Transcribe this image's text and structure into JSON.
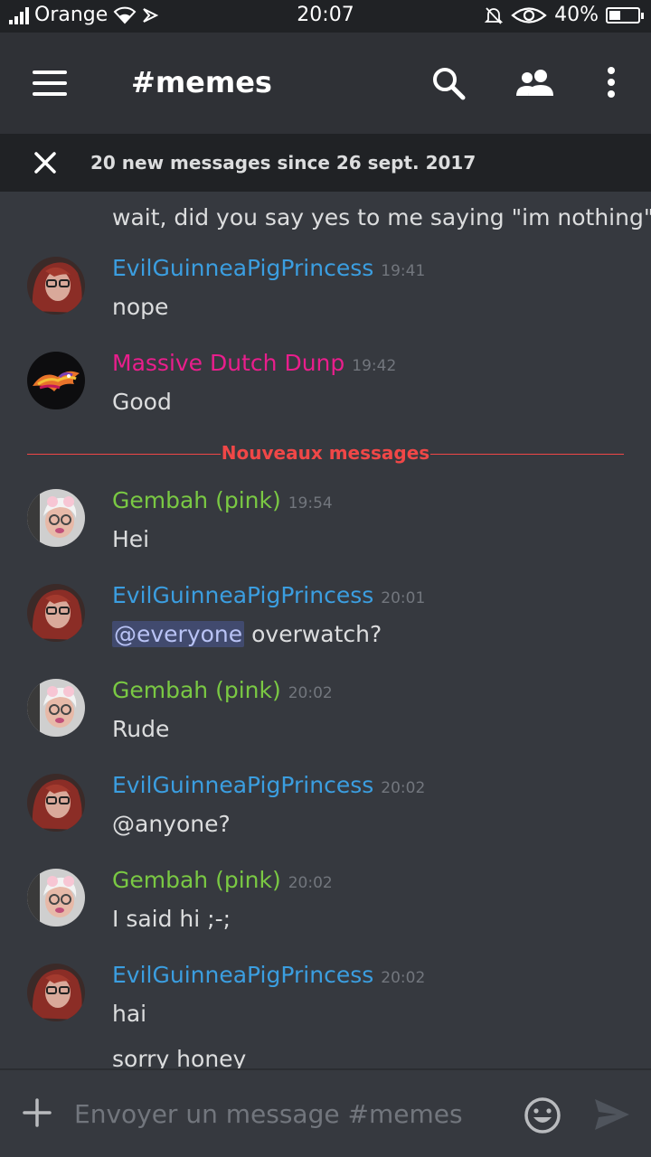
{
  "status_bar": {
    "carrier": "Orange",
    "time": "20:07",
    "battery": "40%",
    "battery_level": 0.4
  },
  "header": {
    "channel_title": "#memes"
  },
  "banner": {
    "text": "20 new messages since 26 sept. 2017"
  },
  "messages": {
    "m0": {
      "text": "wait, did you say yes to me saying \"im nothing\""
    },
    "m1": {
      "author": "EvilGuinneaPigPrincess",
      "time": "19:41",
      "text": "nope"
    },
    "m2": {
      "author": "Massive Dutch Dunp",
      "time": "19:42",
      "text": "Good"
    },
    "divider": "Nouveaux messages",
    "m3": {
      "author": "Gembah (pink)",
      "time": "19:54",
      "text": "Hei"
    },
    "m4": {
      "author": "EvilGuinneaPigPrincess",
      "time": "20:01",
      "mention": "@everyone",
      "text": " overwatch?"
    },
    "m5": {
      "author": "Gembah (pink)",
      "time": "20:02",
      "text": "Rude"
    },
    "m6": {
      "author": "EvilGuinneaPigPrincess",
      "time": "20:02",
      "text": "@anyone?"
    },
    "m7": {
      "author": "Gembah (pink)",
      "time": "20:02",
      "text": "I said hi ;-;"
    },
    "m8": {
      "author": "EvilGuinneaPigPrincess",
      "time": "20:02",
      "text": "hai",
      "text2": "sorry honey"
    }
  },
  "composer": {
    "placeholder": "Envoyer un message #memes"
  },
  "colors": {
    "evil": "#3b9ee0",
    "gembah": "#7ac943",
    "dutch": "#e91e8c",
    "new_messages": "#f04747"
  },
  "icons": [
    "menu-icon",
    "search-icon",
    "members-icon",
    "more-icon",
    "close-icon",
    "plus-icon",
    "emoji-icon",
    "send-icon",
    "wifi-icon",
    "bell-off-icon",
    "eye-icon"
  ]
}
